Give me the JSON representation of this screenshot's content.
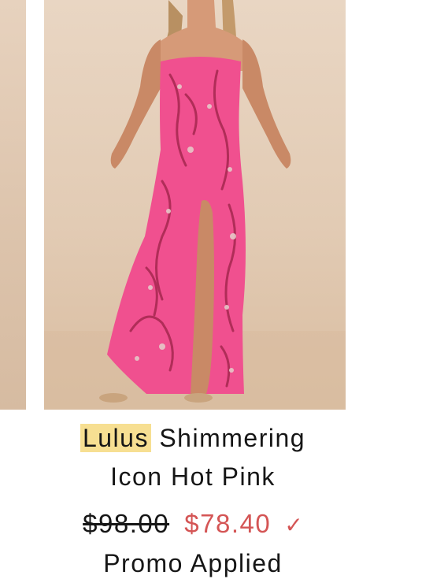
{
  "product": {
    "brand": "Lulus",
    "name_line1": "Shimmering",
    "name_line2": "Icon Hot Pink",
    "original_price": "$98.00",
    "sale_price": "$78.40",
    "check_glyph": "✓",
    "promo_text": "Promo Applied"
  },
  "carousel": {
    "main_image_icon": "dress-photo",
    "prev_image_icon": "previous-photo"
  },
  "colors": {
    "sale_price": "#d45555",
    "brand_highlight": "#f7df92",
    "dress": "#f0508f"
  }
}
